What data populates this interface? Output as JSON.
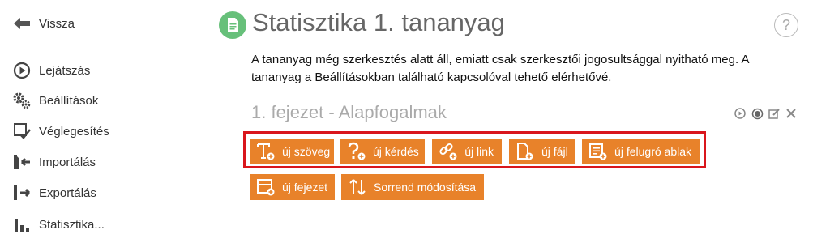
{
  "sidebar": {
    "back_label": "Vissza",
    "items": [
      {
        "label": "Lejátszás",
        "icon": "play-circle-icon"
      },
      {
        "label": "Beállítások",
        "icon": "gears-icon"
      },
      {
        "label": "Véglegesítés",
        "icon": "finalize-check-icon"
      },
      {
        "label": "Importálás",
        "icon": "import-icon"
      },
      {
        "label": "Exportálás",
        "icon": "export-icon"
      },
      {
        "label": "Statisztika...",
        "icon": "bar-chart-icon"
      }
    ]
  },
  "header": {
    "title": "Statisztika 1. tananyag",
    "help_label": "?",
    "icon": "document-icon"
  },
  "notice": "A tananyag még szerkesztés alatt áll, emiatt csak szerkesztői jogosultsággal nyitható meg. A tananyag a Beállításokban található kapcsolóval tehető elérhetővé.",
  "chapter": {
    "title": "1. fejezet - Alapfogalmak"
  },
  "buttons": {
    "new_text": "új szöveg",
    "new_question": "új kérdés",
    "new_link": "új link",
    "new_file": "új fájl",
    "new_popup": "új felugró ablak",
    "new_chapter": "új fejezet",
    "reorder": "Sorrend módosítása"
  },
  "colors": {
    "accent_orange": "#e8822a",
    "highlight_red": "#d9161c",
    "title_icon_green": "#67c07a"
  }
}
